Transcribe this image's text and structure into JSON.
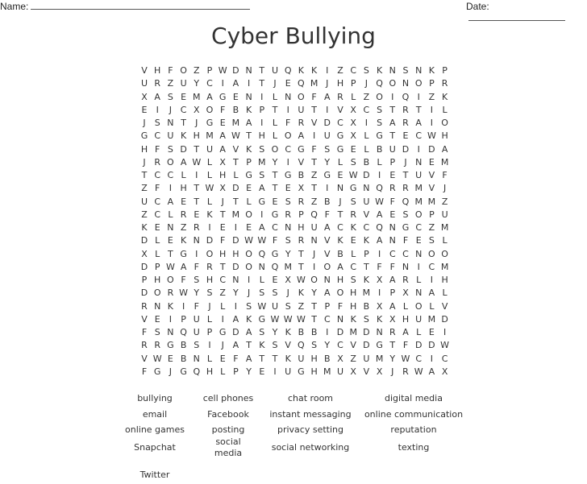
{
  "header": {
    "name_label": "Name:",
    "date_label": "Date:"
  },
  "title": "Cyber Bullying",
  "grid": [
    "VHFOZPWDNTUQKKIZCSKNSNKP",
    "URZUYCIAITJEQMJHPJQONOPR",
    "XASEMAGENILNOFARLZOIQIZK",
    "EIJCXOFBKPTIUTIVXCSTRTIL",
    "JSNTJGEMAILFRVDCXISARAIO",
    "GCUKHMAWTHLOAIUGXLGTECWH",
    "HFSDTUAVKSOCGFSGELBUDIDA",
    "JROAWLXTPMYIVTYLSBLPJNEM",
    "TCCLILHLGSTGBZGEWDIETUVF",
    "ZFIHTWXDEATEXTINGNQRRMVJ",
    "UCAETLJTLGESRZBJSUWFQMMZ",
    "ZCLREKTMOIGRPQFTRVAESOPU",
    "KENZRIEIEACNHUACKCQNGCZM",
    "DLEKNDFDWWFSRNVKEKANFESL",
    "XLTGIOHHOQGYTJVBLPICCNOO",
    "DPWAFRTDONQMTIOACTFFNICM",
    "PHOFSHCNILEXWONHSKXARLIH",
    "DORWYSZYJSSJKYAOHMIPXNAL",
    "RNKIFJLISWUSZTPFHBXALOLV",
    "VEIPULIAKGWWWTCNKSKXHUMD",
    "FSNQUPGDASYKBBIDMDNRALEI",
    "RRGBSIJATKSVQSYCVDGTFDDW",
    "VWEBNLEFATTKUHBXZUMYWCIC",
    "FGJGQHLPYEIUGHMUXVXJRWAX"
  ],
  "word_list": [
    [
      "bullying",
      "cell phones",
      "chat room",
      "digital media"
    ],
    [
      "email",
      "Facebook",
      "instant messaging",
      "online communication"
    ],
    [
      "online games",
      "posting",
      "privacy setting",
      "reputation"
    ],
    [
      "Snapchat",
      "social media",
      "social networking",
      "texting"
    ],
    [
      "Twitter"
    ]
  ]
}
